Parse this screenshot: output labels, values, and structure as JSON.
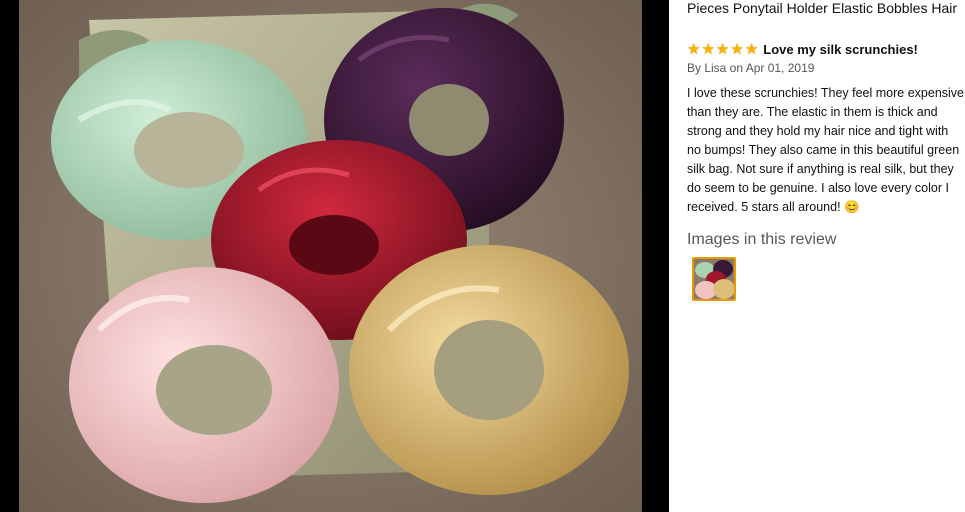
{
  "review_panel": {
    "product_title": "Pieces Ponytail Holder Elastic Bobbles Hair",
    "rating": 5,
    "stars": [
      "★",
      "★",
      "★",
      "★",
      "★"
    ],
    "headline": "Love my silk scrunchies!",
    "byline": "By Lisa on Apr 01, 2019",
    "body": "I love these scrunchies! They feel more expensive than they are. The elastic in them is thick and strong and they hold my hair nice and tight with no bumps! They also came in this beautiful green silk bag. Not sure if anything is real silk, but they do seem to be genuine. I also love every color I received. 5 stars all around! 😊",
    "images_heading": "Images in this review"
  },
  "colors": {
    "star": "#f8b400",
    "thumb_border": "#e79a00",
    "viewer_bg": "#000000",
    "scrunchie_mint": "#a9d3b3",
    "scrunchie_purple": "#3a1838",
    "scrunchie_red": "#a0162a",
    "scrunchie_pink": "#f3c3c4",
    "scrunchie_gold": "#ddbe78"
  }
}
